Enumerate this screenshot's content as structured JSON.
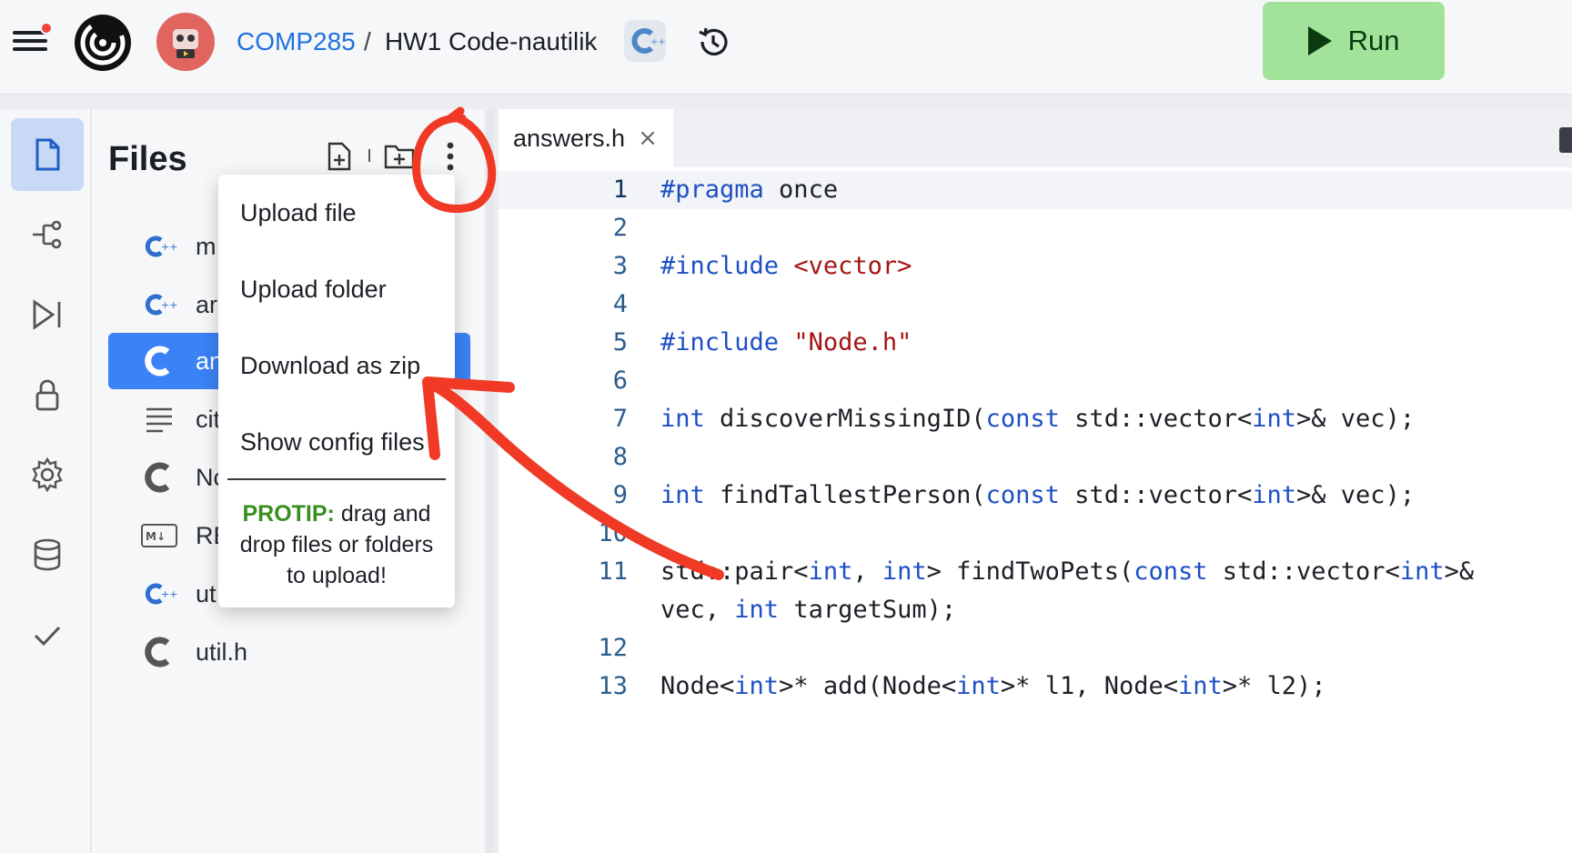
{
  "header": {
    "project": "COMP285",
    "separator": "/",
    "title": "HW1 Code-nautilik",
    "run_label": "Run"
  },
  "files": {
    "title": "Files",
    "items": [
      {
        "name": "m",
        "icon": "cpp-icon"
      },
      {
        "name": "ar",
        "icon": "cpp-icon"
      },
      {
        "name": "an",
        "icon": "c-icon",
        "selected": true
      },
      {
        "name": "cit",
        "icon": "text-lines-icon"
      },
      {
        "name": "Nc",
        "icon": "c-icon"
      },
      {
        "name": "RE",
        "icon": "markdown-icon"
      },
      {
        "name": "ut",
        "icon": "cpp-icon"
      },
      {
        "name": "util.h",
        "icon": "c-icon"
      }
    ]
  },
  "editor": {
    "tab_label": "answers.h",
    "tab_close": "×",
    "line_numbers": [
      "1",
      "2",
      "3",
      "4",
      "5",
      "6",
      "7",
      "8",
      "9",
      "10",
      "11",
      "12",
      "13"
    ]
  },
  "menu": {
    "items": [
      "Upload file",
      "Upload folder",
      "Download as zip",
      "Show config files"
    ],
    "protip_label": "PROTIP:",
    "protip_text": " drag and drop files or folders to upload!"
  },
  "colors": {
    "run_button": "#a1e39a",
    "selected_file": "#3b82f6",
    "annotation": "#f03a26",
    "keyword": "#1d4fc4",
    "string": "#a31515"
  }
}
